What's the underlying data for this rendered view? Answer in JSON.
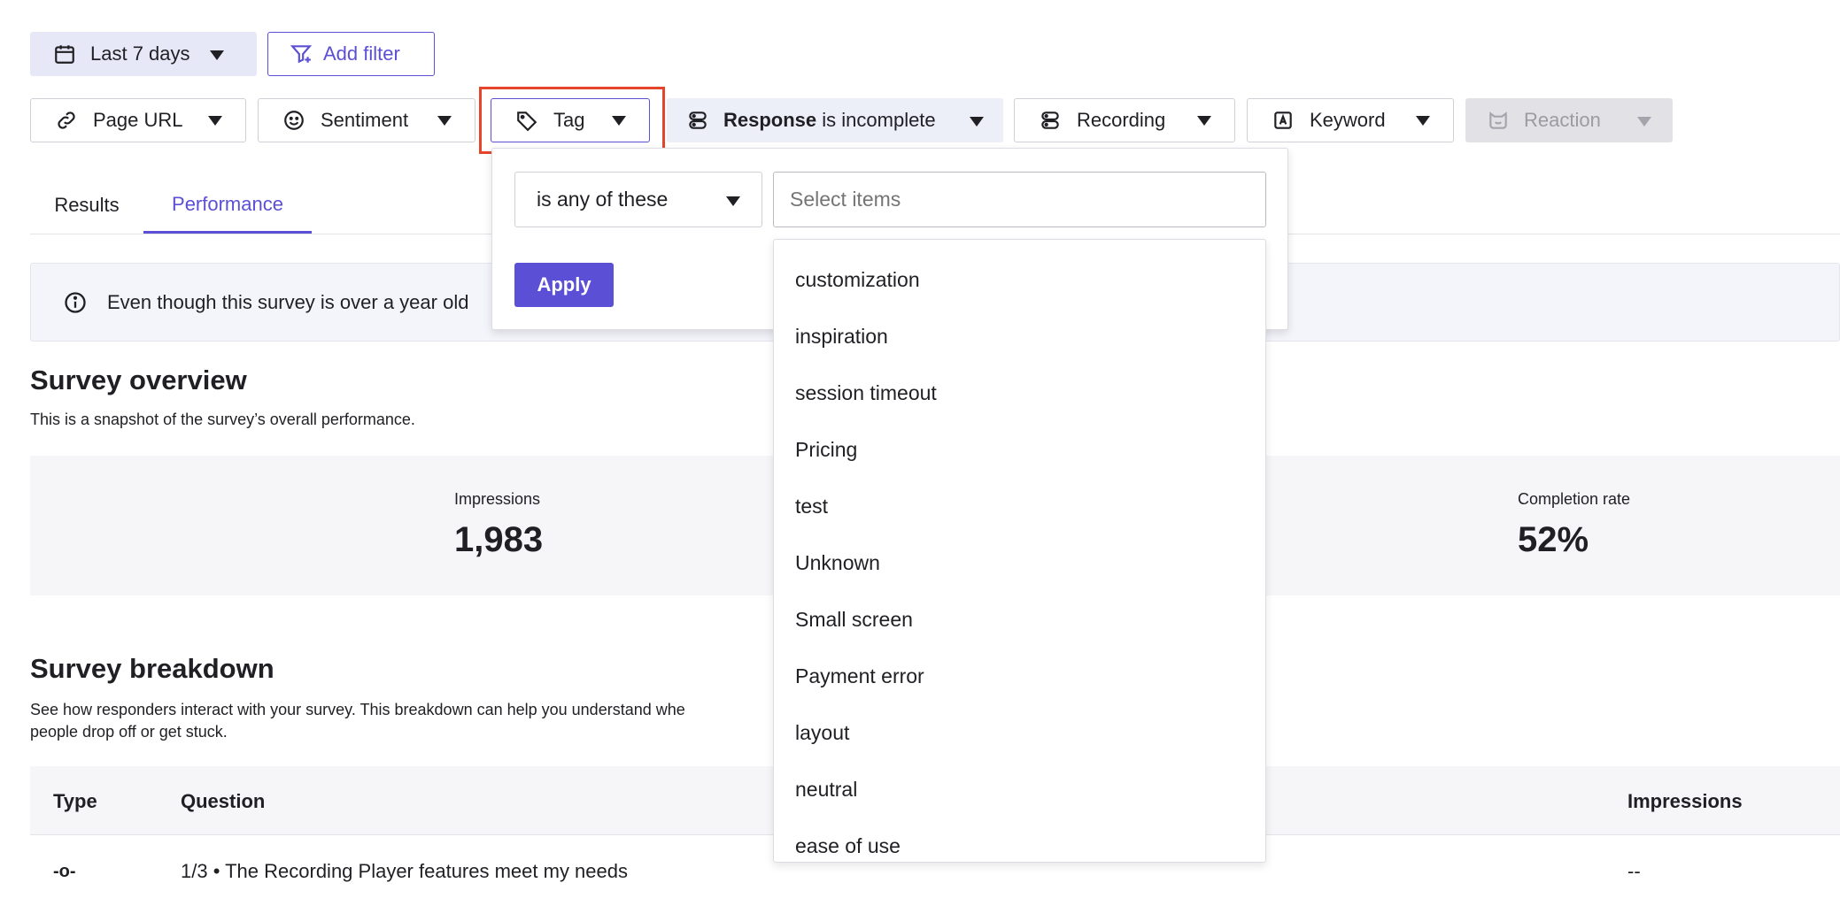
{
  "date_filter": {
    "label": "Last 7 days"
  },
  "add_filter": {
    "label": "Add filter"
  },
  "filters": {
    "page_url": "Page URL",
    "sentiment": "Sentiment",
    "tag": "Tag",
    "response_strong": "Response",
    "response_rest": " is incomplete",
    "recording": "Recording",
    "keyword": "Keyword",
    "reaction": "Reaction"
  },
  "tabs": {
    "results": "Results",
    "performance": "Performance"
  },
  "notice": {
    "text": "Even though this survey is over a year old"
  },
  "overview": {
    "title": "Survey overview",
    "subtitle": "This is a snapshot of the survey’s overall performance.",
    "impressions_label": "Impressions",
    "impressions_value": "1,983",
    "completion_label": "Completion rate",
    "completion_value": "52%"
  },
  "breakdown": {
    "title": "Survey breakdown",
    "subtitle_line1": "See how responders interact with your survey. This breakdown can help you understand whe",
    "subtitle_line2": "people drop off or get stuck.",
    "col_type": "Type",
    "col_question": "Question",
    "col_impressions": "Impressions",
    "row1_type": "-o-",
    "row1_question": "1/3 • The Recording Player features meet my needs",
    "row1_impressions": "--"
  },
  "tag_popover": {
    "operator": "is any of these",
    "search_placeholder": "Select items",
    "apply_label": "Apply",
    "items": [
      "customization",
      "inspiration",
      "session timeout",
      "Pricing",
      "test",
      "Unknown",
      "Small screen",
      "Payment error",
      "layout",
      "neutral",
      "ease of use"
    ]
  },
  "colors": {
    "accent": "#5b4fd6",
    "highlight_border": "#e5452b",
    "date_bg": "#e7e8f7",
    "response_bg": "#eceef8",
    "stats_bg": "#f6f6f8"
  }
}
